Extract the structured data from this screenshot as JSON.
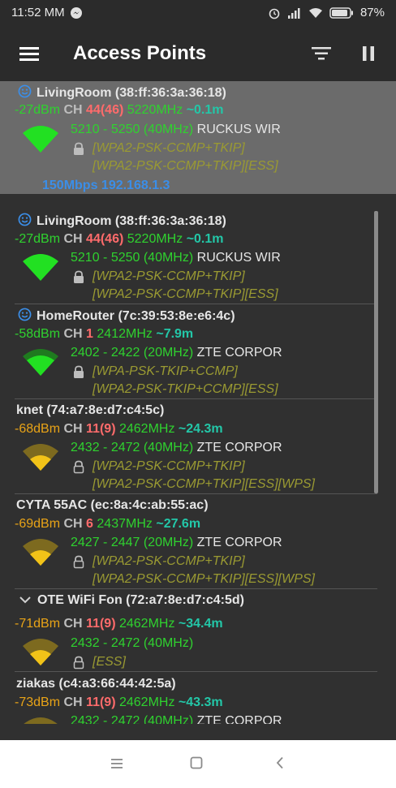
{
  "status_bar": {
    "time": "11:52 MM",
    "battery": "87%"
  },
  "app_bar": {
    "title": "Access Points"
  },
  "access_points": [
    {
      "name": "LivingRoom",
      "mac": "(38:ff:36:3a:36:18)",
      "header_text": "LivingRoom (38:ff:36:3a:36:18)",
      "dbm": "-27dBm",
      "ch_label": "CH",
      "channel": "44(46)",
      "freq": "5220MHz",
      "distance": "~0.1m",
      "range": "5210 - 5250 (40MHz)",
      "vendor": "RUCKUS WIR",
      "cap1": "[WPA2-PSK-CCMP+TKIP]",
      "cap2": "[WPA2-PSK-CCMP+TKIP][ESS]",
      "extra": "150Mbps 192.168.1.3",
      "selected": true,
      "signal": "strong",
      "connected": true
    },
    {
      "name": "LivingRoom",
      "header_text": "LivingRoom (38:ff:36:3a:36:18)",
      "dbm": "-27dBm",
      "ch_label": "CH",
      "channel": "44(46)",
      "freq": "5220MHz",
      "distance": "~0.1m",
      "range": "5210 - 5250 (40MHz)",
      "vendor": "RUCKUS WIR",
      "cap1": "[WPA2-PSK-CCMP+TKIP]",
      "cap2": "[WPA2-PSK-CCMP+TKIP][ESS]",
      "signal": "strong",
      "connected": true
    },
    {
      "header_text": "HomeRouter (7c:39:53:8e:e6:4c)",
      "dbm": "-58dBm",
      "ch_label": "CH",
      "channel": "1",
      "freq": "2412MHz",
      "distance": "~7.9m",
      "range": "2402 - 2422 (20MHz)",
      "vendor": "ZTE CORPOR",
      "cap1": "[WPA-PSK-TKIP+CCMP]",
      "cap2": "[WPA2-PSK-TKIP+CCMP][ESS]",
      "signal": "good",
      "connected": true
    },
    {
      "header_text": "knet (74:a7:8e:d7:c4:5c)",
      "dbm": "-68dBm",
      "ch_label": "CH",
      "channel": "11(9)",
      "freq": "2462MHz",
      "distance": "~24.3m",
      "range": "2432 - 2472 (40MHz)",
      "vendor": "ZTE CORPOR",
      "cap1": "[WPA2-PSK-CCMP+TKIP]",
      "cap2": "[WPA2-PSK-CCMP+TKIP][ESS][WPS]",
      "signal": "medium"
    },
    {
      "header_text": "CYTA 55AC (ec:8a:4c:ab:55:ac)",
      "dbm": "-69dBm",
      "ch_label": "CH",
      "channel": "6",
      "freq": "2437MHz",
      "distance": "~27.6m",
      "range": "2427 - 2447 (20MHz)",
      "vendor": "ZTE CORPOR",
      "cap1": "[WPA2-PSK-CCMP+TKIP]",
      "cap2": "[WPA2-PSK-CCMP+TKIP][ESS][WPS]",
      "signal": "medium"
    },
    {
      "header_text": "OTE WiFi Fon (72:a7:8e:d7:c4:5d)",
      "dbm": "-71dBm",
      "ch_label": "CH",
      "channel": "11(9)",
      "freq": "2462MHz",
      "distance": "~34.4m",
      "range": "2432 - 2472 (40MHz)",
      "vendor": "",
      "cap1": "[ESS]",
      "cap2": "",
      "signal": "medium",
      "expandable": true
    },
    {
      "header_text": "ziakas (c4:a3:66:44:42:5a)",
      "dbm": "-73dBm",
      "ch_label": "CH",
      "channel": "11(9)",
      "freq": "2462MHz",
      "distance": "~43.3m",
      "range": "2432 - 2472 (40MHz)",
      "vendor": "ZTE CORPOR",
      "signal": "medium"
    }
  ],
  "colors": {
    "strong": "#22e022",
    "medium": "#f2c318",
    "bar_bg": "#2b2b2b",
    "selected_bg": "#6b6b6b"
  },
  "icons": {
    "menu": "menu-icon",
    "filter": "filter-icon",
    "pause": "pause-icon",
    "connected": "smiley-icon",
    "lock": "lock-icon",
    "wifi": "wifi-signal-icon"
  }
}
